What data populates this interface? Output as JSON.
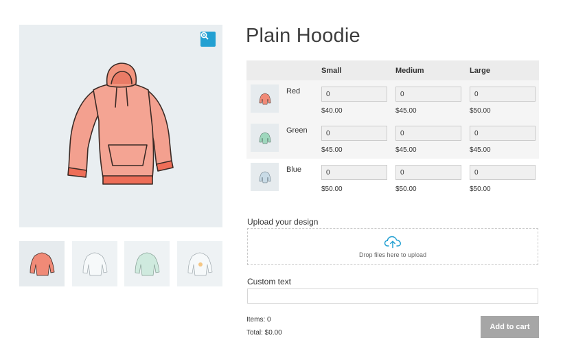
{
  "product": {
    "title": "Plain Hoodie"
  },
  "gallery": {
    "zoom_icon": "zoom-in-icon",
    "main_color": "#f08a77",
    "thumbnails": [
      {
        "color": "#f08a77"
      },
      {
        "color": "#dde8ee"
      },
      {
        "color": "#bfe3d4"
      },
      {
        "color": "#e7edf1"
      }
    ]
  },
  "variations": {
    "headers": [
      "Small",
      "Medium",
      "Large"
    ],
    "rows": [
      {
        "color": "Red",
        "swatch": "#f08a77",
        "quantities": [
          "0",
          "0",
          "0"
        ],
        "prices": [
          "$40.00",
          "$45.00",
          "$50.00"
        ]
      },
      {
        "color": "Green",
        "swatch": "#9ed7bd",
        "quantities": [
          "0",
          "0",
          "0"
        ],
        "prices": [
          "$45.00",
          "$45.00",
          "$45.00"
        ]
      },
      {
        "color": "Blue",
        "swatch": "#c9dbe6",
        "quantities": [
          "0",
          "0",
          "0"
        ],
        "prices": [
          "$50.00",
          "$50.00",
          "$50.00"
        ]
      }
    ]
  },
  "upload": {
    "label": "Upload your design",
    "drop_text": "Drop files here to upload",
    "icon": "cloud-upload-icon",
    "accent": "#23a0d2"
  },
  "custom_text": {
    "label": "Custom text",
    "value": ""
  },
  "summary": {
    "items": "Items: 0",
    "total": "Total: $0.00"
  },
  "cart": {
    "button_label": "Add to cart"
  }
}
